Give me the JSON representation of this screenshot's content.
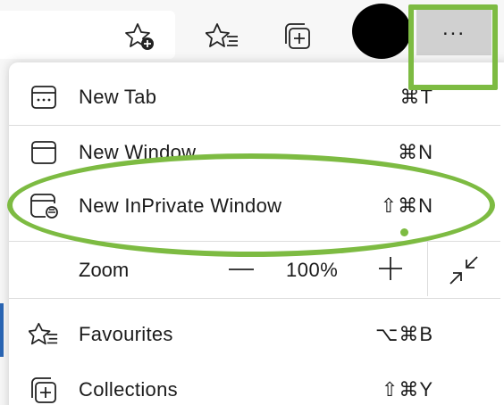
{
  "toolbar": {
    "more_label": "..."
  },
  "menu": {
    "items": [
      {
        "label": "New Tab",
        "shortcut": "⌘T"
      },
      {
        "label": "New Window",
        "shortcut": "⌘N"
      },
      {
        "label": "New InPrivate Window",
        "shortcut": "⇧⌘N"
      },
      {
        "label": "Favourites",
        "shortcut": "⌥⌘B"
      },
      {
        "label": "Collections",
        "shortcut": "⇧⌘Y"
      }
    ],
    "zoom": {
      "label": "Zoom",
      "minus": "—",
      "value": "100%",
      "plus": "+"
    }
  },
  "colors": {
    "highlight": "#7dbb42",
    "more_button_bg": "#d0d0d0",
    "accent_blue": "#2a66b5"
  }
}
